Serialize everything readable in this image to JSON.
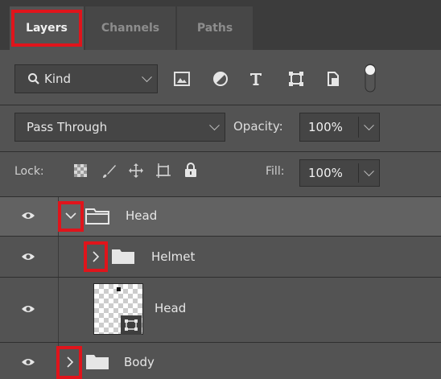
{
  "tabs": [
    {
      "label": "Layers",
      "active": true
    },
    {
      "label": "Channels",
      "active": false
    },
    {
      "label": "Paths",
      "active": false
    }
  ],
  "filter": {
    "kind_label": "Kind",
    "kind_icon": "search-icon"
  },
  "filter_icons": [
    "image-filter-icon",
    "adjustment-filter-icon",
    "type-filter-icon",
    "shape-filter-icon",
    "smart-object-filter-icon",
    "filter-toggle-icon"
  ],
  "blend": {
    "mode": "Pass Through",
    "opacity_label": "Opacity:",
    "opacity_value": "100%"
  },
  "lock": {
    "label": "Lock:",
    "fill_label": "Fill:",
    "fill_value": "100%",
    "icons": [
      "lock-transparent-pixels-icon",
      "lock-image-pixels-icon",
      "lock-position-icon",
      "lock-artboard-icon",
      "lock-all-icon"
    ]
  },
  "layers": [
    {
      "name": "Head",
      "type": "group",
      "expanded": true,
      "indent": 0,
      "selected": true
    },
    {
      "name": "Helmet",
      "type": "group",
      "expanded": false,
      "indent": 1,
      "selected": false
    },
    {
      "name": "Head",
      "type": "layer",
      "indent": 1,
      "selected": false
    },
    {
      "name": "Body",
      "type": "group",
      "expanded": false,
      "indent": 0,
      "selected": false
    }
  ],
  "colors": {
    "panel_bg": "#535353",
    "selected_row": "#626262",
    "highlight": "#e0141b",
    "tab_bar": "#3c3c3c"
  }
}
